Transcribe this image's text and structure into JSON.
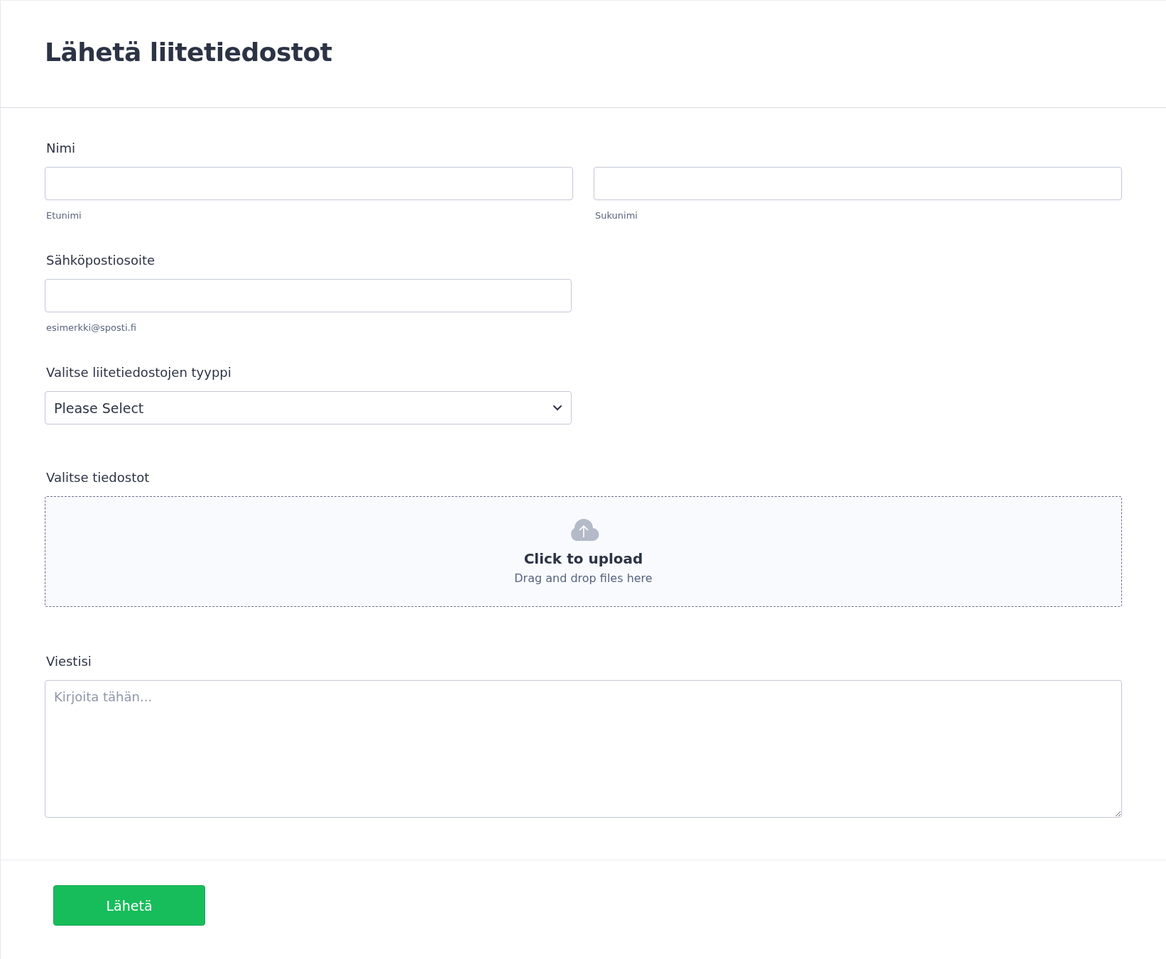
{
  "title": "Lähetä liitetiedostot",
  "fields": [
    {
      "kind": "name",
      "label": "Nimi",
      "parts": [
        {
          "sublabel": "Etunimi"
        },
        {
          "sublabel": "Sukunimi"
        }
      ]
    },
    {
      "kind": "email",
      "label": "Sähköpostiosoite",
      "sublabel": "esimerkki@sposti.fi"
    },
    {
      "kind": "select",
      "label": "Valitse liitetiedostojen tyyppi",
      "value": "Please Select"
    },
    {
      "kind": "upload",
      "label": "Valitse tiedostot",
      "title": "Click to upload",
      "hint": "Drag and drop files here"
    },
    {
      "kind": "textarea",
      "label": "Viestisi",
      "placeholder": "Kirjoita tähän..."
    }
  ],
  "submit": "Lähetä"
}
